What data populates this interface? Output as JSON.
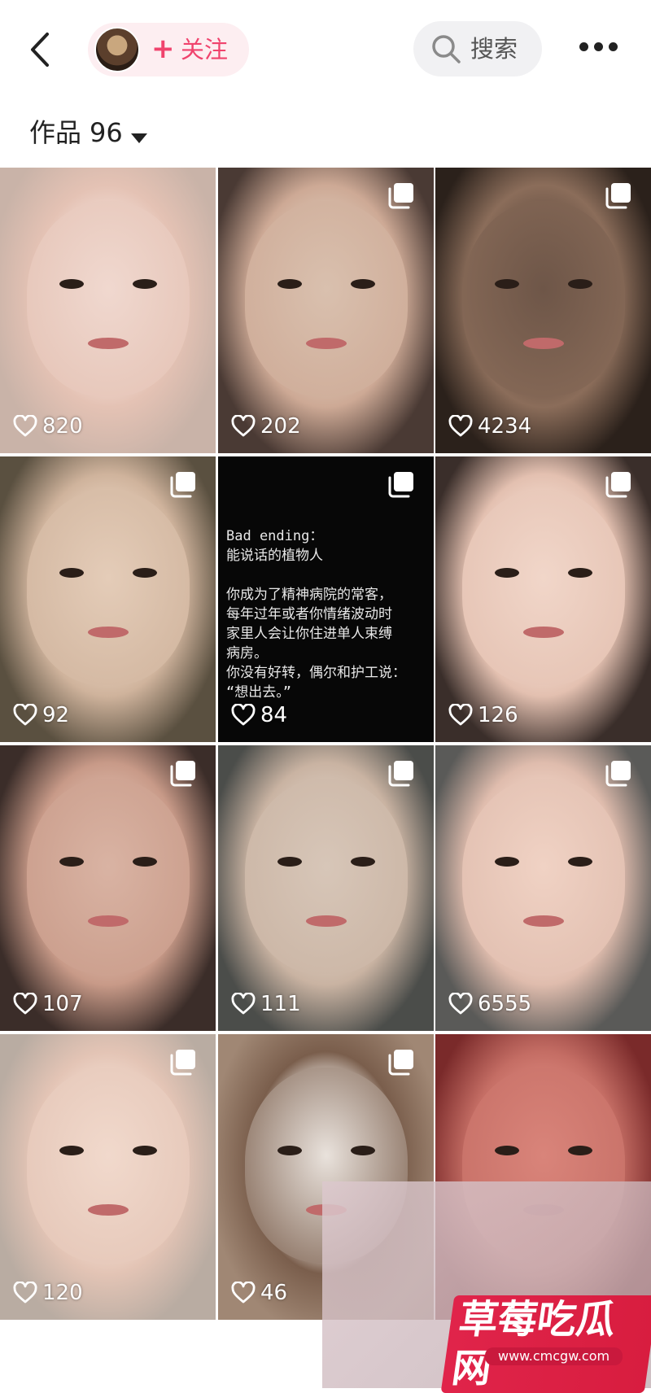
{
  "header": {
    "follow_label": "关注",
    "follow_plus": "+",
    "search_label": "搜索"
  },
  "works": {
    "label": "作品",
    "count": "96"
  },
  "grid": [
    {
      "likes": "820",
      "multi": false
    },
    {
      "likes": "202",
      "multi": true
    },
    {
      "likes": "4234",
      "multi": true
    },
    {
      "likes": "92",
      "multi": true
    },
    {
      "likes": "84",
      "multi": true,
      "text": true
    },
    {
      "likes": "126",
      "multi": true
    },
    {
      "likes": "107",
      "multi": true
    },
    {
      "likes": "111",
      "multi": true
    },
    {
      "likes": "6555",
      "multi": true
    },
    {
      "likes": "120",
      "multi": true
    },
    {
      "likes": "46",
      "multi": true
    },
    {
      "likes": "",
      "multi": false
    }
  ],
  "text_post": {
    "lines": [
      "Bad ending：",
      "能说话的植物人",
      "",
      "你成为了精神病院的常客，",
      "每年过年或者你情绪波动时",
      "家里人会让你住进单人束缚",
      "病房。",
      "你没有好转，偶尔和护工说：",
      "“想出去。”"
    ]
  },
  "watermark": {
    "title": "草莓吃瓜网",
    "url": "www.cmcgw.com"
  },
  "icons": {
    "back": "chevron-left-icon",
    "search": "search-icon",
    "more": "more-dots-icon",
    "multi": "multi-image-icon",
    "like": "heart-outline-icon"
  },
  "colors": {
    "accent": "#f0436d",
    "pill_bg": "#fdeef1",
    "search_bg": "#f1f1f3"
  }
}
